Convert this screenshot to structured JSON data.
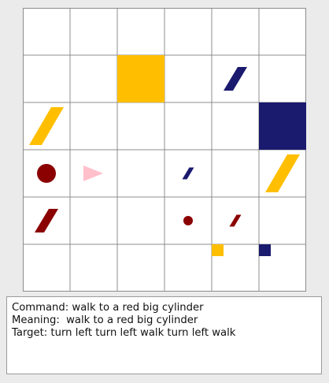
{
  "window": {
    "background": "#ebebeb"
  },
  "grid": {
    "rows": 6,
    "cols": 6,
    "line_color": "#8c8c8c",
    "background": "#ffffff",
    "objects": [
      {
        "name": "yellow-big-square",
        "shape": "square",
        "size": "big",
        "color": "#ffbf00",
        "row": 1,
        "col": 2
      },
      {
        "name": "blue-small-cylinder-r1c4",
        "shape": "cylinder",
        "size": "small",
        "color": "#1a1a6e",
        "row": 1,
        "col": 4
      },
      {
        "name": "yellow-big-cylinder-r2c0",
        "shape": "cylinder",
        "size": "big",
        "color": "#ffbf00",
        "row": 2,
        "col": 0
      },
      {
        "name": "blue-big-square",
        "shape": "square",
        "size": "big",
        "color": "#1a1a6e",
        "row": 2,
        "col": 5
      },
      {
        "name": "red-circle-r3c0",
        "shape": "circle",
        "size": "medium",
        "color": "#8b0000",
        "row": 3,
        "col": 0
      },
      {
        "name": "agent-triangle",
        "shape": "triangle",
        "size": "medium",
        "color": "#ffc0cb",
        "row": 3,
        "col": 1
      },
      {
        "name": "blue-tiny-cylinder-r3c3",
        "shape": "cylinder",
        "size": "tiny",
        "color": "#1a1a6e",
        "row": 3,
        "col": 3
      },
      {
        "name": "yellow-big-cylinder-r3c5",
        "shape": "cylinder",
        "size": "big",
        "color": "#ffbf00",
        "row": 3,
        "col": 5
      },
      {
        "name": "red-small-cylinder-r4c0",
        "shape": "cylinder",
        "size": "small",
        "color": "#8b0000",
        "row": 4,
        "col": 0
      },
      {
        "name": "red-small-circle-r4c3",
        "shape": "circle",
        "size": "small",
        "color": "#8b0000",
        "row": 4,
        "col": 3
      },
      {
        "name": "red-tiny-cylinder-r4c4",
        "shape": "cylinder",
        "size": "tiny",
        "color": "#8b0000",
        "row": 4,
        "col": 4
      },
      {
        "name": "yellow-small-square",
        "shape": "square",
        "size": "small",
        "color": "#ffbf00",
        "row": 5,
        "col": 4
      },
      {
        "name": "blue-small-square",
        "shape": "square",
        "size": "small",
        "color": "#1a1a6e",
        "row": 5,
        "col": 5
      }
    ]
  },
  "info": {
    "command": "Command: walk to a red big cylinder",
    "meaning": "Meaning:  walk to a red big cylinder",
    "target": "Target: turn left turn left walk turn left walk"
  }
}
